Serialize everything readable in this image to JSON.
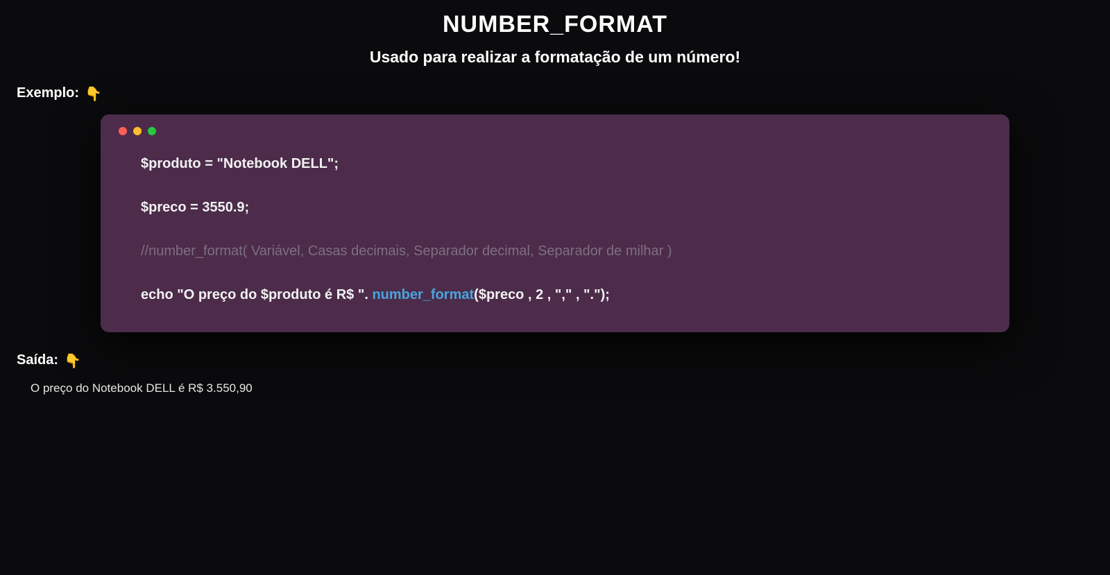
{
  "title": "NUMBER_FORMAT",
  "subtitle": "Usado para realizar a formatação de um número!",
  "example_label": "Exemplo:",
  "pointer_emoji": "👇",
  "code": {
    "line1": "$produto = \"Notebook DELL\";",
    "line2": "$preco = 3550.9;",
    "comment": "//number_format( Variável, Casas decimais, Separador decimal, Separador de milhar )",
    "echo_prefix": "echo \"O preço do $produto é R$ \". ",
    "fn_name": "number_format",
    "echo_suffix": "($preco , 2 , \",\" , \".\");"
  },
  "output_label": "Saída:",
  "output_text": "O preço do Notebook DELL é R$ 3.550,90"
}
